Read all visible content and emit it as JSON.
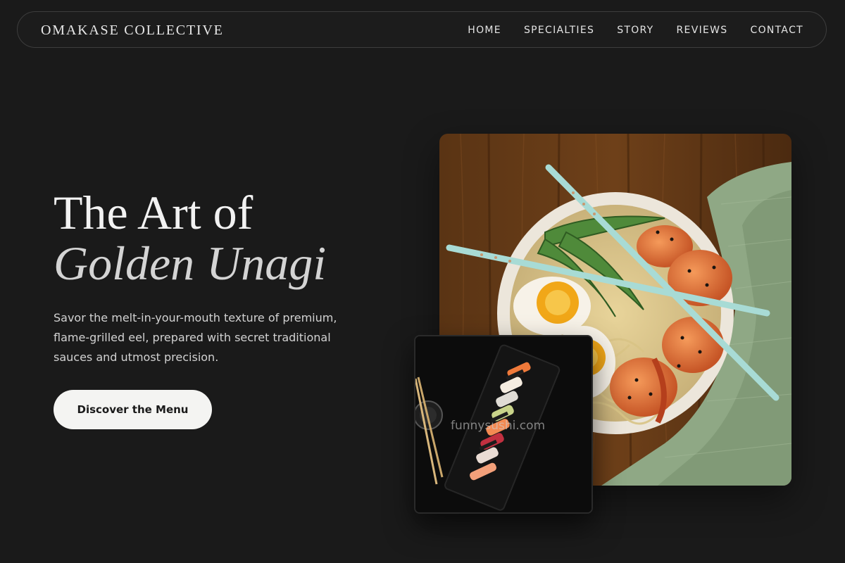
{
  "nav": {
    "brand": "OMAKASE COLLECTIVE",
    "links": [
      "HOME",
      "SPECIALTIES",
      "STORY",
      "REVIEWS",
      "CONTACT"
    ]
  },
  "hero": {
    "title_line1": "The Art of",
    "title_line2": "Golden Unagi",
    "subtitle": "Savor the melt-in-your-mouth texture of premium, flame-grilled eel, prepared with secret traditional sauces and utmost precision.",
    "cta_label": "Discover the Menu"
  },
  "images": {
    "secondary_watermark": "funnysushi.com"
  },
  "colors": {
    "background": "#1a1a1a",
    "cta_background": "#f4f4f2",
    "cta_text": "#1a1a1a",
    "nav_border": "#3d3d3d"
  }
}
